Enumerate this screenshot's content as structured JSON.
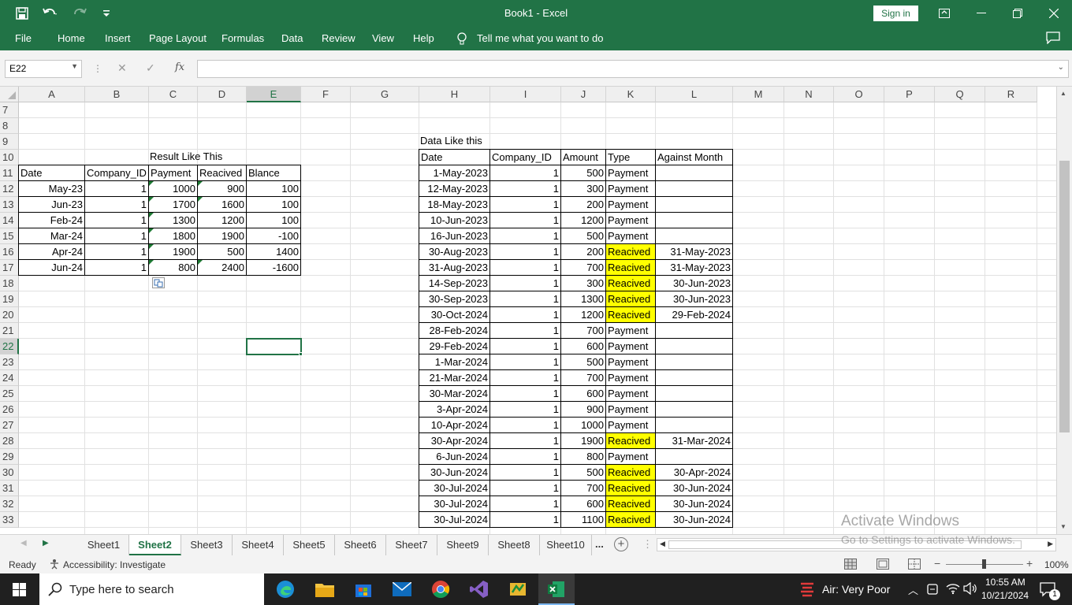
{
  "window": {
    "title": "Book1  -  Excel",
    "sign_in": "Sign in"
  },
  "menu": [
    "File",
    "Home",
    "Insert",
    "Page Layout",
    "Formulas",
    "Data",
    "Review",
    "View",
    "Help"
  ],
  "tell_me": "Tell me what you want to do",
  "name_box": "E22",
  "formula": "",
  "columns": [
    "A",
    "B",
    "C",
    "D",
    "E",
    "F",
    "G",
    "H",
    "I",
    "J",
    "K",
    "L",
    "M",
    "N",
    "O",
    "P",
    "Q",
    "R"
  ],
  "rows": [
    "7",
    "8",
    "9",
    "10",
    "11",
    "12",
    "13",
    "14",
    "15",
    "16",
    "17",
    "18",
    "19",
    "20",
    "21",
    "22",
    "23",
    "24",
    "25",
    "26",
    "27",
    "28",
    "29",
    "30",
    "31",
    "32",
    "33"
  ],
  "result_table": {
    "title": "Result Like This",
    "headers": [
      "Date",
      "Company_ID",
      "Payment",
      "Reacived",
      "Blance"
    ],
    "rows": [
      [
        "May-23",
        "1",
        "1000",
        "900",
        "100"
      ],
      [
        "Jun-23",
        "1",
        "1700",
        "1600",
        "100"
      ],
      [
        "Feb-24",
        "1",
        "1300",
        "1200",
        "100"
      ],
      [
        "Mar-24",
        "1",
        "1800",
        "1900",
        "-100"
      ],
      [
        "Apr-24",
        "1",
        "1900",
        "500",
        "1400"
      ],
      [
        "Jun-24",
        "1",
        "800",
        "2400",
        "-1600"
      ]
    ]
  },
  "data_table": {
    "title": "Data Like this",
    "headers": [
      "Date",
      "Company_ID",
      "Amount",
      "Type",
      "Against Month"
    ],
    "rows": [
      [
        "1-May-2023",
        "1",
        "500",
        "Payment",
        ""
      ],
      [
        "12-May-2023",
        "1",
        "300",
        "Payment",
        ""
      ],
      [
        "18-May-2023",
        "1",
        "200",
        "Payment",
        ""
      ],
      [
        "10-Jun-2023",
        "1",
        "1200",
        "Payment",
        ""
      ],
      [
        "16-Jun-2023",
        "1",
        "500",
        "Payment",
        ""
      ],
      [
        "30-Aug-2023",
        "1",
        "200",
        "Reacived",
        "31-May-2023"
      ],
      [
        "31-Aug-2023",
        "1",
        "700",
        "Reacived",
        "31-May-2023"
      ],
      [
        "14-Sep-2023",
        "1",
        "300",
        "Reacived",
        "30-Jun-2023"
      ],
      [
        "30-Sep-2023",
        "1",
        "1300",
        "Reacived",
        "30-Jun-2023"
      ],
      [
        "30-Oct-2024",
        "1",
        "1200",
        "Reacived",
        "29-Feb-2024"
      ],
      [
        "28-Feb-2024",
        "1",
        "700",
        "Payment",
        ""
      ],
      [
        "29-Feb-2024",
        "1",
        "600",
        "Payment",
        ""
      ],
      [
        "1-Mar-2024",
        "1",
        "500",
        "Payment",
        ""
      ],
      [
        "21-Mar-2024",
        "1",
        "700",
        "Payment",
        ""
      ],
      [
        "30-Mar-2024",
        "1",
        "600",
        "Payment",
        ""
      ],
      [
        "3-Apr-2024",
        "1",
        "900",
        "Payment",
        ""
      ],
      [
        "10-Apr-2024",
        "1",
        "1000",
        "Payment",
        ""
      ],
      [
        "30-Apr-2024",
        "1",
        "1900",
        "Reacived",
        "31-Mar-2024"
      ],
      [
        "6-Jun-2024",
        "1",
        "800",
        "Payment",
        ""
      ],
      [
        "30-Jun-2024",
        "1",
        "500",
        "Reacived",
        "30-Apr-2024"
      ],
      [
        "30-Jul-2024",
        "1",
        "700",
        "Reacived",
        "30-Jun-2024"
      ],
      [
        "30-Jul-2024",
        "1",
        "600",
        "Reacived",
        "30-Jun-2024"
      ],
      [
        "30-Jul-2024",
        "1",
        "1100",
        "Reacived",
        "30-Jun-2024"
      ]
    ]
  },
  "sheets": [
    "Sheet1",
    "Sheet2",
    "Sheet3",
    "Sheet4",
    "Sheet5",
    "Sheet6",
    "Sheet7",
    "Sheet9",
    "Sheet8",
    "Sheet10"
  ],
  "active_sheet": "Sheet2",
  "sheet_more": "...",
  "status": {
    "ready": "Ready",
    "accessibility": "Accessibility: Investigate",
    "zoom": "100%"
  },
  "watermark": {
    "line1": "Activate Windows",
    "line2": "Go to Settings to activate Windows."
  },
  "taskbar": {
    "search": "Type here to search",
    "air": "Air: Very Poor",
    "time": "10:55 AM",
    "date": "10/21/2024",
    "notif_count": "1"
  },
  "colors": {
    "excel_green": "#217346",
    "highlight": "#ffff00"
  }
}
